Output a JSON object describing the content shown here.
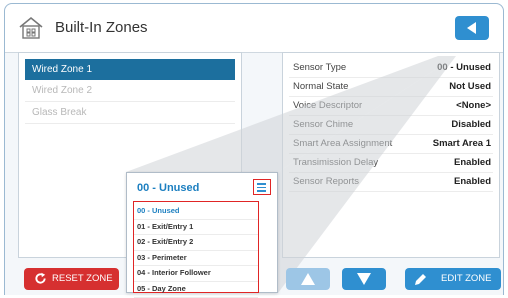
{
  "header": {
    "title": "Built-In Zones",
    "home_icon": "home-icon",
    "back_icon": "back-arrow-icon"
  },
  "zones": [
    {
      "label": "Wired Zone 1",
      "selected": true
    },
    {
      "label": "Wired Zone 2",
      "selected": false
    },
    {
      "label": "Glass Break",
      "selected": false
    }
  ],
  "properties": [
    {
      "key": "Sensor Type",
      "value": "00 - Unused"
    },
    {
      "key": "Normal State",
      "value": "Not Used"
    },
    {
      "key": "Voice Descriptor",
      "value": "<None>"
    },
    {
      "key": "Sensor Chime",
      "value": "Disabled"
    },
    {
      "key": "Smart Area Assignment",
      "value": "Smart Area 1"
    },
    {
      "key": "Transimission Delay",
      "value": "Enabled"
    },
    {
      "key": "Sensor Reports",
      "value": "Enabled"
    }
  ],
  "popup": {
    "title": "00 - Unused",
    "menu_icon": "menu-icon",
    "options": [
      {
        "label": "00 - Unused",
        "active": true
      },
      {
        "label": "01 - Exit/Entry 1",
        "active": false
      },
      {
        "label": "02 - Exit/Entry 2",
        "active": false
      },
      {
        "label": "03 - Perimeter",
        "active": false
      },
      {
        "label": "04 - Interior Follower",
        "active": false
      },
      {
        "label": "05 - Day Zone",
        "active": false
      }
    ]
  },
  "footer": {
    "reset_label": "RESET ZONE",
    "edit_label": "EDIT ZONE"
  },
  "colors": {
    "accent": "#2f8fd0",
    "selected_row": "#1c6f9e",
    "danger": "#d63030",
    "highlight_box": "#e02525"
  }
}
